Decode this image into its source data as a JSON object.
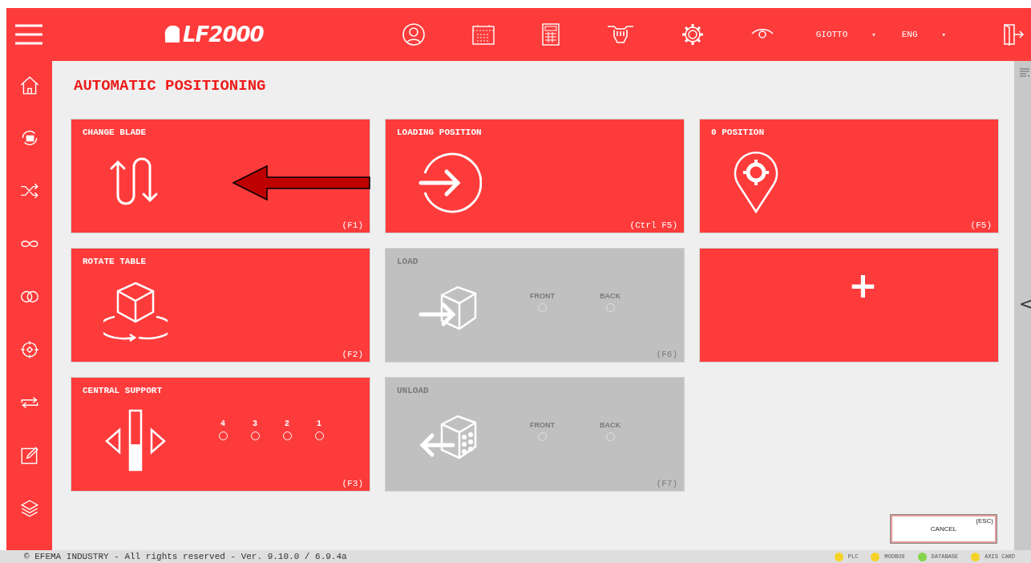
{
  "header": {
    "logo": "LF2000",
    "user": "GIOTTO",
    "user_caret": "▾",
    "language": "ENG",
    "language_caret": "▾"
  },
  "title": "AUTOMATIC POSITIONING",
  "tiles": [
    {
      "kind": "blade",
      "title": "CHANGE BLADE",
      "shortcut": "(F1)",
      "disabled": false
    },
    {
      "kind": "entry",
      "title": "LOADING POSITION",
      "shortcut": "(Ctrl F5)",
      "disabled": false
    },
    {
      "kind": "pin",
      "title": "0 POSITION",
      "shortcut": "(F5)",
      "disabled": false
    },
    {
      "kind": "rotate",
      "title": "ROTATE TABLE",
      "shortcut": "(F2)",
      "disabled": false
    },
    {
      "kind": "load",
      "title": "LOAD",
      "shortcut": "(F6)",
      "disabled": true,
      "options": [
        {
          "label": "FRONT",
          "selected": false
        },
        {
          "label": "BACK",
          "selected": false
        }
      ]
    },
    {
      "kind": "add",
      "symbol": "+",
      "disabled": false
    },
    {
      "kind": "support",
      "title": "CENTRAL SUPPORT",
      "shortcut": "(F3)",
      "disabled": false,
      "options": [
        {
          "label": "4",
          "selected": false
        },
        {
          "label": "3",
          "selected": false
        },
        {
          "label": "2",
          "selected": false
        },
        {
          "label": "1",
          "selected": false
        }
      ]
    },
    {
      "kind": "unload",
      "title": "UNLOAD",
      "shortcut": "(F7)",
      "disabled": true,
      "options": [
        {
          "label": "FRONT",
          "selected": false
        },
        {
          "label": "BACK",
          "selected": false
        }
      ]
    }
  ],
  "cancel": {
    "shortcut": "(ESC)",
    "label": "CANCEL"
  },
  "side_toggle": "<",
  "footer": {
    "copyright": "© EFEMA INDUSTRY - All rights reserved - Ver. 9.10.0 / 6.9.4a",
    "indicators": [
      {
        "label": "PLC",
        "color": "#f5d327"
      },
      {
        "label": "MODBUS",
        "color": "#f5d327"
      },
      {
        "label": "DATABASE",
        "color": "#86d64c"
      },
      {
        "label": "AXIS CARD",
        "color": "#f5d327"
      }
    ]
  }
}
